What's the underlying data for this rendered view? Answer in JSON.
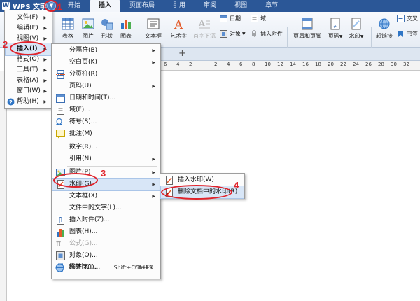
{
  "app": {
    "brand": "WPS 文字"
  },
  "tabs": [
    "开始",
    "插入",
    "页面布局",
    "引用",
    "审阅",
    "视图",
    "章节"
  ],
  "ribbon": {
    "table": "表格",
    "picture": "图片",
    "shape": "形状",
    "chart": "图表",
    "textbox": "文本框",
    "wordart": "艺术字",
    "dropcap": "首字下沉",
    "date": "日期",
    "field": "域",
    "object": "对象",
    "attachment": "插入附件",
    "header_footer": "页眉和页脚",
    "page_number": "页码",
    "watermark": "水印",
    "hyperlink": "超链接",
    "cross_ref": "交叉",
    "bookmark": "书签"
  },
  "ruler": {
    "marks": [
      "6",
      "4",
      "2",
      "",
      "2",
      "4",
      "6",
      "8",
      "10",
      "12",
      "14",
      "16",
      "18",
      "20",
      "22",
      "24",
      "26",
      "28",
      "30",
      "32"
    ]
  },
  "doc": {
    "new_tab": "+"
  },
  "main_menu": [
    {
      "label": "文件(F)"
    },
    {
      "label": "编辑(E)"
    },
    {
      "label": "视图(V)"
    },
    {
      "label": "插入(I)"
    },
    {
      "label": "格式(O)"
    },
    {
      "label": "工具(T)"
    },
    {
      "label": "表格(A)"
    },
    {
      "label": "窗口(W)"
    },
    {
      "label": "帮助(H)"
    }
  ],
  "insert_menu": [
    {
      "label": "分隔符(B)"
    },
    {
      "label": "空白页(K)"
    },
    {
      "label": "分页符(R)"
    },
    {
      "label": "页码(U)"
    },
    {
      "label": "日期和时间(T)..."
    },
    {
      "label": "域(F)..."
    },
    {
      "label": "符号(S)..."
    },
    {
      "label": "批注(M)"
    },
    {
      "label": "数字(R)..."
    },
    {
      "label": "引用(N)"
    },
    {
      "label": "图片(P)"
    },
    {
      "label": "水印(G)"
    },
    {
      "label": "文本框(X)"
    },
    {
      "label": "文件中的文字(L)..."
    },
    {
      "label": "插入附件(Z)..."
    },
    {
      "label": "图表(H)..."
    },
    {
      "label": "公式(G)..."
    },
    {
      "label": "对象(O)..."
    },
    {
      "label": "书签(K)...",
      "shortcut": "Shift+Ctrl+F5"
    },
    {
      "label": "超链接(I)...",
      "shortcut": "Ctrl+K"
    }
  ],
  "watermark_menu": [
    {
      "label": "插入水印(W)"
    },
    {
      "label": "删除文档中的水印(R)"
    }
  ],
  "annotations": [
    "1",
    "2",
    "3",
    "4"
  ],
  "colors": {
    "title_bar": "#2b5797",
    "highlight": "#d8e6f7",
    "annotation_red": "#e0222a"
  }
}
